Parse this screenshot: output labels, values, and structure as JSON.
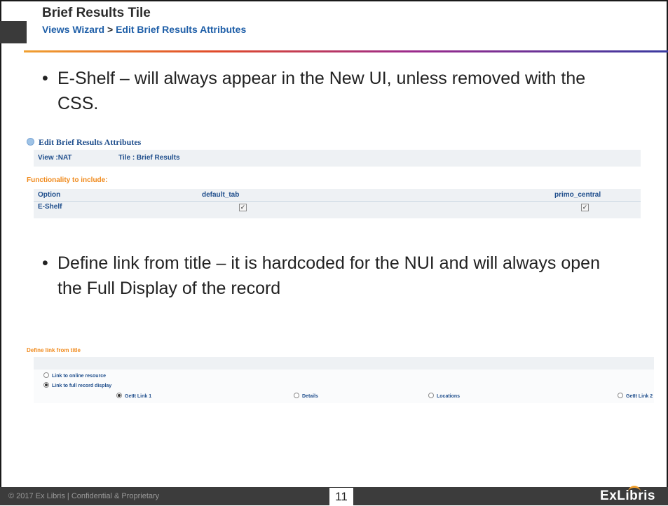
{
  "header": {
    "title": "Brief Results Tile",
    "crumb_first": "Views Wizard",
    "crumb_sep": ">",
    "crumb_second": "Edit Brief Results Attributes"
  },
  "bullets": [
    {
      "symbol": "•",
      "text": "E-Shelf – will always appear in the New UI, unless removed with the CSS."
    },
    {
      "symbol": "•",
      "text": "Define link from title – it is hardcoded for the NUI and will always open the Full Display of the record"
    }
  ],
  "panel1": {
    "title": "Edit Brief Results Attributes",
    "view_label": "View :NAT",
    "tile_label": "Tile : Brief Results",
    "functionality_label": "Functionality to include:",
    "columns": [
      "Option",
      "default_tab",
      "primo_central"
    ],
    "rows": [
      {
        "option": "E-Shelf",
        "default_tab_checked": true,
        "primo_central_checked": true
      }
    ]
  },
  "panel2": {
    "label": "Define link from title",
    "options": [
      {
        "label": "Link to online resource",
        "selected": false
      },
      {
        "label": "Link to full record display",
        "selected": true
      }
    ],
    "sub_options": [
      {
        "label": "GetIt Link 1",
        "selected": true
      },
      {
        "label": "Details",
        "selected": false
      },
      {
        "label": "Locations",
        "selected": false
      },
      {
        "label": "GetIt Link 2",
        "selected": false
      }
    ]
  },
  "footer": {
    "copyright": "© 2017 Ex Libris | Confidential & Proprietary",
    "page_number": "11",
    "logo_text": "ExLibris"
  },
  "colors": {
    "accent_orange": "#f08a1c",
    "link_blue": "#1f5fa8",
    "footer_bg": "#3c3c3c"
  }
}
